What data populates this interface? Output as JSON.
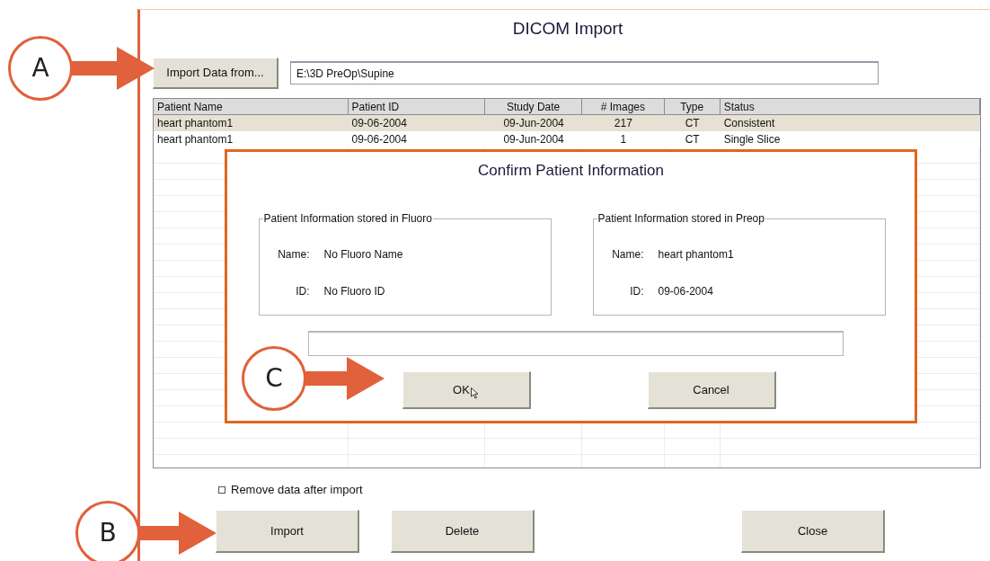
{
  "window": {
    "title": "DICOM Import"
  },
  "import_button": "Import Data from...",
  "path_field": {
    "value": "E:\\3D PreOp\\Supine"
  },
  "table": {
    "columns": [
      "Patient Name",
      "Patient ID",
      "Study Date",
      "# Images",
      "Type",
      "Status"
    ],
    "rows": [
      {
        "selected": true,
        "cells": [
          "heart phantom1",
          "09-06-2004",
          "09-Jun-2004",
          "217",
          "CT",
          "Consistent"
        ]
      },
      {
        "selected": false,
        "cells": [
          "heart phantom1",
          "09-06-2004",
          "09-Jun-2004",
          "1",
          "CT",
          "Single Slice"
        ]
      }
    ]
  },
  "dialog": {
    "title": "Confirm Patient Information",
    "groups": [
      {
        "title": "Patient Information stored in Fluoro",
        "fields": [
          {
            "label": "Name:",
            "value": "No Fluoro Name"
          },
          {
            "label": "ID:",
            "value": "No Fluoro ID"
          }
        ]
      },
      {
        "title": "Patient Information stored in Preop",
        "fields": [
          {
            "label": "Name:",
            "value": "heart phantom1"
          },
          {
            "label": "ID:",
            "value": "09-06-2004"
          }
        ]
      }
    ],
    "buttons": [
      "OK",
      "Cancel"
    ]
  },
  "remove_checkbox": {
    "label": "Remove data after import",
    "checked": false
  },
  "buttons": [
    "Import",
    "Delete",
    "Close"
  ],
  "callouts": [
    {
      "label": "A"
    },
    {
      "label": "B"
    },
    {
      "label": "C"
    }
  ]
}
